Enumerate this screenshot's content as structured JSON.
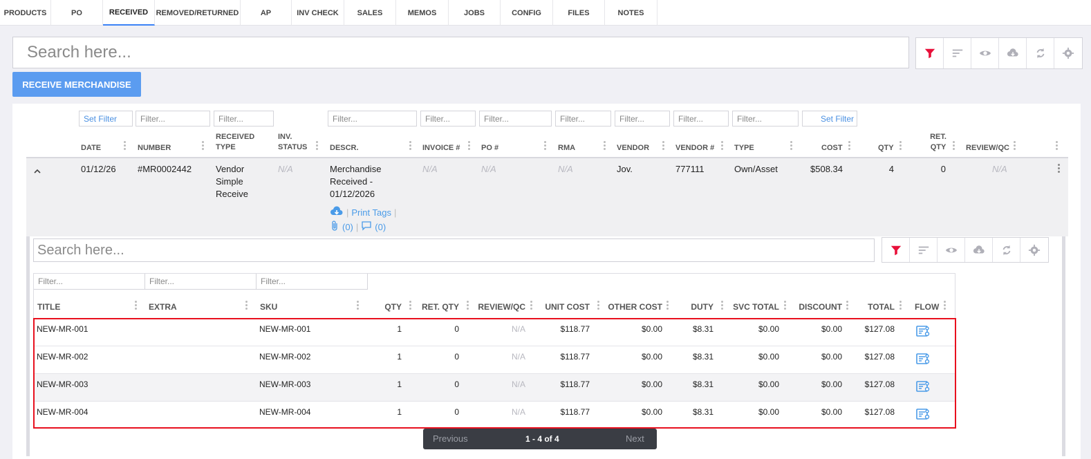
{
  "tabs": [
    "PRODUCTS",
    "PO",
    "RECEIVED",
    "REMOVED/RETURNED",
    "AP",
    "INV CHECK",
    "SALES",
    "MEMOS",
    "JOBS",
    "CONFIG",
    "FILES",
    "NOTES"
  ],
  "search": {
    "placeholder": "Search here..."
  },
  "receive_button": "RECEIVE MERCHANDISE",
  "filters": {
    "set_filter": "Set Filter",
    "placeholder": "Filter..."
  },
  "columns": {
    "date": "DATE",
    "number": "NUMBER",
    "received_type": "RECEIVED TYPE",
    "inv_status": "INV. STATUS",
    "descr": "DESCR.",
    "invoice": "INVOICE #",
    "po": "PO #",
    "rma": "RMA",
    "vendor": "VENDOR",
    "vendor_num": "VENDOR #",
    "type": "TYPE",
    "cost": "COST",
    "qty": "QTY",
    "ret_qty": "RET. QTY",
    "review": "REVIEW/QC"
  },
  "record": {
    "date": "01/12/26",
    "number": "#MR0002442",
    "received_type": [
      "Vendor",
      "Simple",
      "Receive"
    ],
    "inv_status": "N/A",
    "descr": [
      "Merchandise",
      "Received -",
      "01/12/2026"
    ],
    "invoice": "N/A",
    "po": "N/A",
    "rma": "N/A",
    "vendor": "Jov.",
    "vendor_num": "777111",
    "type": "Own/Asset",
    "cost": "$508.34",
    "qty": "4",
    "ret_qty": "0",
    "review": "N/A",
    "print_tags": "Print Tags",
    "attachments": "(0)",
    "comments": "(0)"
  },
  "sub_search": {
    "placeholder": "Search here..."
  },
  "sub_columns": [
    "TITLE",
    "EXTRA",
    "SKU",
    "QTY",
    "RET. QTY",
    "REVIEW/QC",
    "UNIT COST",
    "OTHER COST",
    "DUTY",
    "SVC TOTAL",
    "DISCOUNT",
    "TOTAL",
    "FLOW"
  ],
  "items": [
    {
      "title": "NEW-MR-001",
      "sku": "NEW-MR-001",
      "qty": "1",
      "ret_qty": "0",
      "review": "N/A",
      "unit_cost": "$118.77",
      "other_cost": "$0.00",
      "duty": "$8.31",
      "svc_total": "$0.00",
      "discount": "$0.00",
      "total": "$127.08"
    },
    {
      "title": "NEW-MR-002",
      "sku": "NEW-MR-002",
      "qty": "1",
      "ret_qty": "0",
      "review": "N/A",
      "unit_cost": "$118.77",
      "other_cost": "$0.00",
      "duty": "$8.31",
      "svc_total": "$0.00",
      "discount": "$0.00",
      "total": "$127.08"
    },
    {
      "title": "NEW-MR-003",
      "sku": "NEW-MR-003",
      "qty": "1",
      "ret_qty": "0",
      "review": "N/A",
      "unit_cost": "$118.77",
      "other_cost": "$0.00",
      "duty": "$8.31",
      "svc_total": "$0.00",
      "discount": "$0.00",
      "total": "$127.08"
    },
    {
      "title": "NEW-MR-004",
      "sku": "NEW-MR-004",
      "qty": "1",
      "ret_qty": "0",
      "review": "N/A",
      "unit_cost": "$118.77",
      "other_cost": "$0.00",
      "duty": "$8.31",
      "svc_total": "$0.00",
      "discount": "$0.00",
      "total": "$127.08"
    }
  ],
  "pager": {
    "previous": "Previous",
    "info": "1 - 4 of 4",
    "next": "Next"
  },
  "colors": {
    "accent": "#5b9cf0",
    "filter_active": "#e8103a",
    "highlight": "#e8101e",
    "link": "#4a9be8"
  }
}
